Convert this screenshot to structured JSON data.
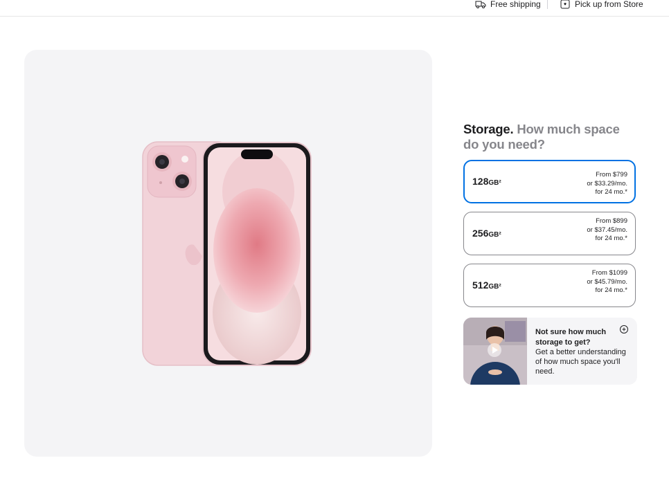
{
  "topbar": {
    "shipping_label": "Free shipping",
    "pickup_label": "Pick up from Store"
  },
  "storage": {
    "heading_bold": "Storage.",
    "heading_light": "How much space do you need?",
    "options": [
      {
        "capacity": "128",
        "unit": "GB²",
        "price": "From $799",
        "monthly": "or $33.29/mo.",
        "term": "for 24 mo.*",
        "selected": true
      },
      {
        "capacity": "256",
        "unit": "GB²",
        "price": "From $899",
        "monthly": "or $37.45/mo.",
        "term": "for 24 mo.*",
        "selected": false
      },
      {
        "capacity": "512",
        "unit": "GB²",
        "price": "From $1099",
        "monthly": "or $45.79/mo.",
        "term": "for 24 mo.*",
        "selected": false
      }
    ],
    "help": {
      "title": "Not sure how much storage to get?",
      "description": "Get a better understanding of how much space you'll need.",
      "icon": "plus-circle-icon"
    }
  },
  "colors": {
    "accent": "#0071e3",
    "phone_pink": "#f4d6dc"
  }
}
